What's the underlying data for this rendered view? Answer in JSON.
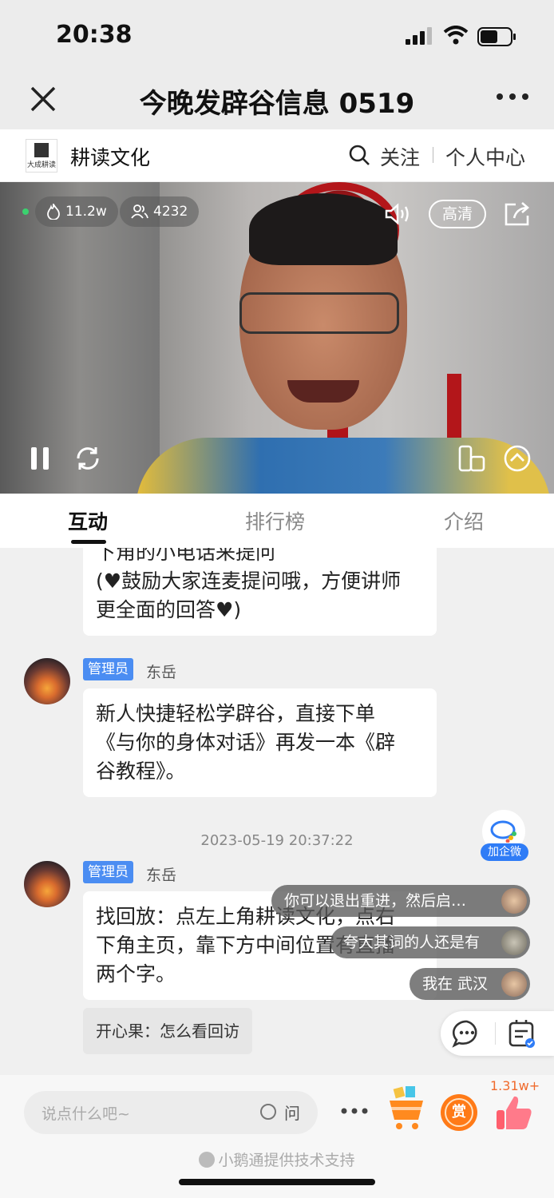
{
  "status_bar": {
    "time": "20:38"
  },
  "header": {
    "title": "今晚发辟谷信息 0519"
  },
  "shop": {
    "logo_text": "大成耕读",
    "name": "耕读文化",
    "follow": "关注",
    "personal_center": "个人中心"
  },
  "video": {
    "heat": "11.2w",
    "viewers": "4232",
    "quality": "高清"
  },
  "tabs": [
    {
      "label": "互动"
    },
    {
      "label": "排行榜"
    },
    {
      "label": "介绍"
    }
  ],
  "messages": [
    {
      "text_line1": "下角的小电话来提问",
      "text_line2": "(♥鼓励大家连麦提问哦，方便讲师",
      "text_line3": "更全面的回答♥)"
    },
    {
      "badge": "管理员",
      "user": "东岳",
      "line1": "新人快捷轻松学辟谷，直接下单",
      "line2": "《与你的身体对话》再发一本《辟",
      "line3": "谷教程》。"
    },
    {
      "timestamp": "2023-05-19 20:37:22"
    },
    {
      "badge": "管理员",
      "user": "东岳",
      "line1": "找回放：点左上角耕读文化，点右",
      "line2": "下角主页，靠下方中间位置有直播",
      "line3": "两个字。"
    }
  ],
  "reply": {
    "text": "开心果：怎么看回访"
  },
  "qiwei": {
    "label": "加企微"
  },
  "floating_messages": [
    {
      "text": "你可以退出重进，然后启…"
    },
    {
      "text": "夸大其词的人还是有"
    },
    {
      "text": "我在 武汉"
    }
  ],
  "bottom": {
    "placeholder": "说点什么吧~",
    "ask": "问",
    "reward": "赏",
    "likes": "1.31w+",
    "support": "小鹅通提供技术支持"
  }
}
